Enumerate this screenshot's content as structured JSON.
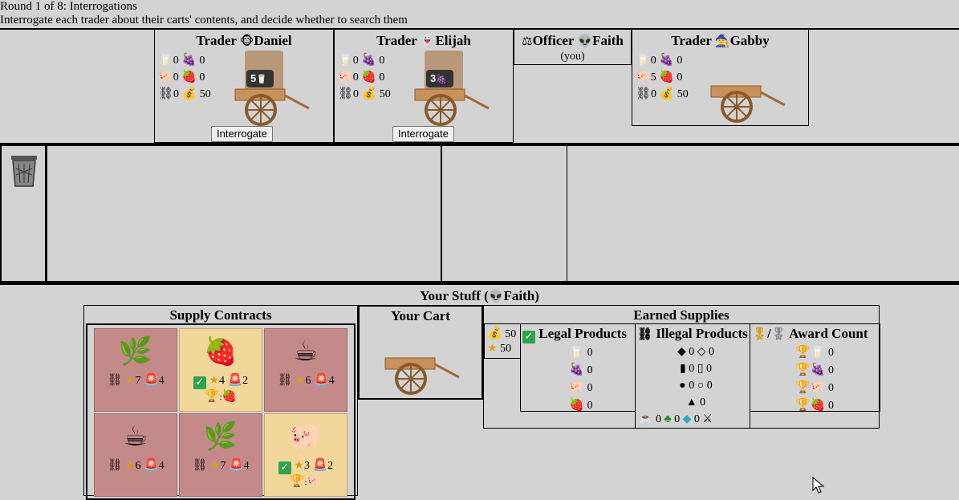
{
  "header": {
    "round": "Round 1 of 8: Interrogations",
    "instruction": "Interrogate each trader about their carts' contents, and decide whether to search them"
  },
  "players": [
    {
      "role": "Trader",
      "avatar": "🐵",
      "name": "Daniel",
      "milk": "0",
      "grapes": "0",
      "pig": "0",
      "strawberry": "0",
      "contraband": "0",
      "gold": "50",
      "cart_count": "5",
      "button": "Interrogate"
    },
    {
      "role": "Trader",
      "avatar": "👻",
      "name": "Elijah",
      "milk": "0",
      "grapes": "0",
      "pig": "0",
      "strawberry": "0",
      "contraband": "0",
      "gold": "50",
      "cart_count": "3",
      "button": "Interrogate"
    },
    {
      "role": "Officer",
      "avatar": "👽",
      "name": "Faith",
      "you": "(you)"
    },
    {
      "role": "Trader",
      "avatar": "🧙",
      "name": "Gabby",
      "milk": "0",
      "grapes": "0",
      "pig": "5",
      "strawberry": "0",
      "contraband": "0",
      "gold": "50"
    }
  ],
  "your_stuff": {
    "title": "Your Stuff (",
    "avatar": "👽",
    "name": "Faith",
    "close": ")",
    "supply_contracts_title": "Supply Contracts",
    "your_cart_title": "Your Cart",
    "earned_supplies_title": "Earned Supplies",
    "gold": "50",
    "stars": "50",
    "legal_title": "Legal Products",
    "illegal_title": "Illegal Products",
    "award_title": "Award Count",
    "award_sep": "/",
    "legal": [
      "0",
      "0",
      "0",
      "0"
    ],
    "illegal": {
      "r1": "0",
      "r1b": "0",
      "r2": "0",
      "r2b": "0",
      "r3": "0",
      "r3b": "0",
      "r4": "0",
      "coffee": "0",
      "herb": "0",
      "gem": "0"
    },
    "awards": [
      "0",
      "0",
      "0",
      "0"
    ]
  },
  "contracts": [
    {
      "icon": "🌿",
      "legal": false,
      "stars": "7",
      "siren": "4"
    },
    {
      "icon": "🍓",
      "legal": true,
      "stars": "4",
      "siren": "2",
      "bonus": "🍓"
    },
    {
      "icon": "☕",
      "legal": false,
      "stars": "6",
      "siren": "4"
    },
    {
      "icon": "☕",
      "legal": false,
      "stars": "6",
      "siren": "4"
    },
    {
      "icon": "🌿",
      "legal": false,
      "stars": "7",
      "siren": "4"
    },
    {
      "icon": "🐖",
      "legal": true,
      "stars": "3",
      "siren": "2",
      "bonus": "🐖"
    }
  ],
  "icons": {
    "milk": "🥛",
    "grapes": "🍇",
    "pig": "🐖",
    "strawberry": "🍓",
    "contraband": "⛓",
    "gold": "💰",
    "star": "★",
    "siren": "🚨",
    "trash": "🗑",
    "scale": "⚖",
    "check": "✓",
    "trophy": "🏆",
    "medal": "🎖"
  },
  "colors": {
    "background": "#d3d3d3",
    "check": "#2da44e",
    "contract_illegal": "#c48a8a",
    "contract_legal": "#f2d79a"
  }
}
